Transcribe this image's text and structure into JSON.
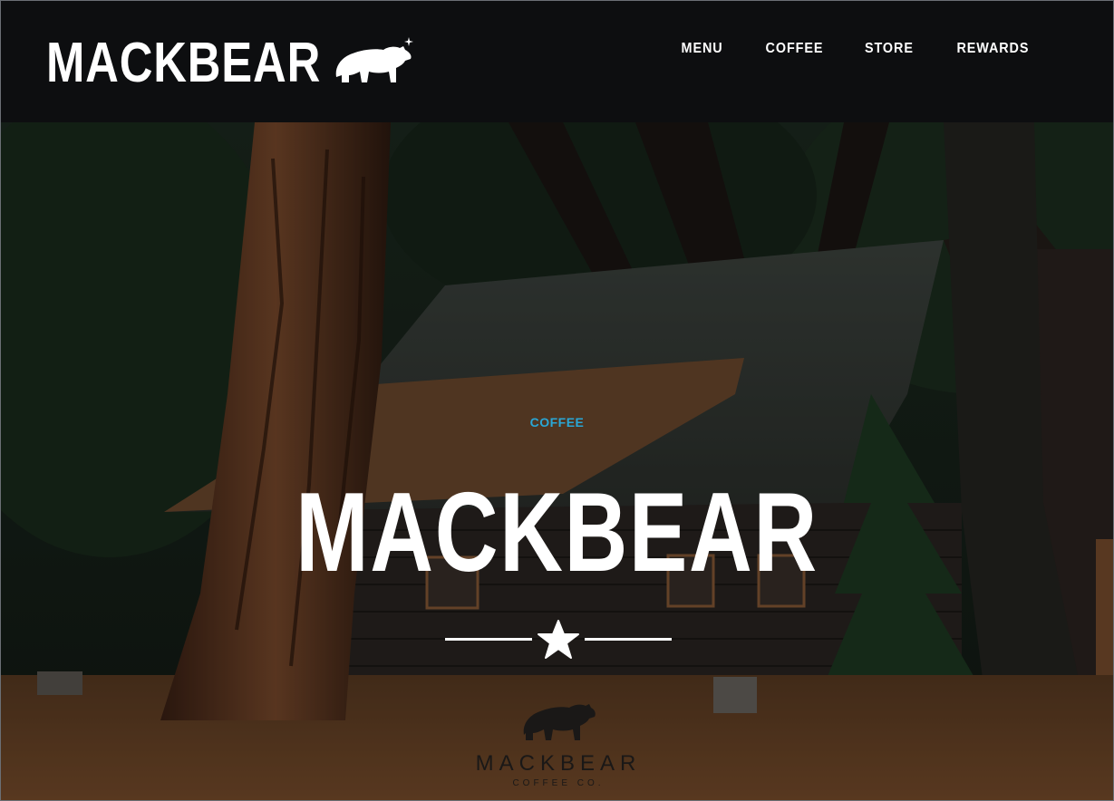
{
  "header": {
    "brand": "MACKBEAR",
    "nav": [
      "MENU",
      "COFFEE",
      "STORE",
      "REWARDS"
    ]
  },
  "hero": {
    "eyebrow": "COFFEE",
    "title": "MACKBEAR",
    "logo_name": "MACKBEAR",
    "logo_sub": "COFFEE CO."
  },
  "icons": {
    "brand": "bear-icon",
    "divider": "star-icon",
    "logo": "bear-icon"
  },
  "colors": {
    "nav_bg": "#0d0e10",
    "accent": "#2aa7d6",
    "text": "#ffffff"
  }
}
